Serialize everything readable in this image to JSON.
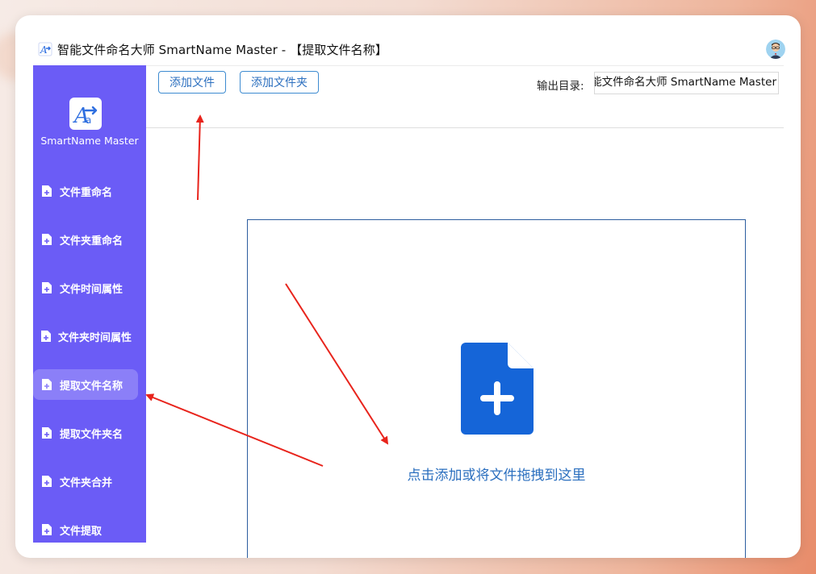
{
  "window": {
    "title": "智能文件命名大师 SmartName Master - 【提取文件名称】"
  },
  "sidebar": {
    "logo_text": "SmartName Master",
    "items": [
      {
        "label": "文件重命名",
        "active": false
      },
      {
        "label": "文件夹重命名",
        "active": false
      },
      {
        "label": "文件时间属性",
        "active": false
      },
      {
        "label": "文件夹时间属性",
        "active": false
      },
      {
        "label": "提取文件名称",
        "active": true
      },
      {
        "label": "提取文件夹名",
        "active": false
      },
      {
        "label": "文件夹合并",
        "active": false
      },
      {
        "label": "文件提取",
        "active": false
      }
    ]
  },
  "toolbar": {
    "add_file_label": "添加文件",
    "add_folder_label": "添加文件夹",
    "output_label": "输出目录:",
    "output_value": "智能文件命名大师 SmartName Master"
  },
  "dropzone": {
    "hint": "点击添加或将文件拖拽到这里"
  },
  "colors": {
    "sidebar_bg": "#6b5cf6",
    "sidebar_active": "#8b7ff8",
    "accent_blue": "#2b6fbf",
    "file_icon_blue": "#1565d8",
    "annotation_red": "#e8241c"
  }
}
